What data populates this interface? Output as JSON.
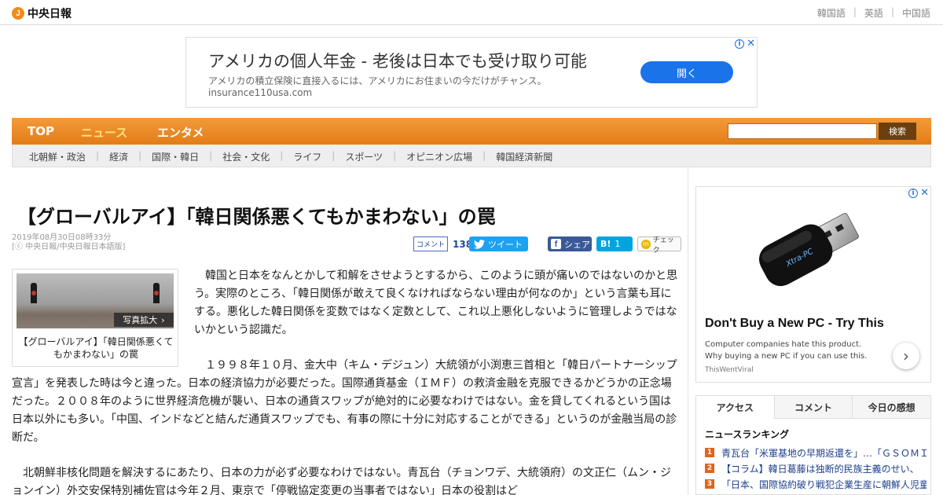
{
  "header": {
    "logo_text": "中央日報",
    "logo_mark": "J",
    "languages": [
      "韓国語",
      "英語",
      "中国語"
    ]
  },
  "top_ad": {
    "title": "アメリカの個人年金 - 老後は日本でも受け取り可能",
    "description": "アメリカの積立保険に直接入るには、アメリカにお住まいの今だけがチャンス。",
    "url": "insurance110usa.com",
    "button_label": "開く"
  },
  "nav": {
    "items": [
      {
        "label": "TOP"
      },
      {
        "label": "ニュース"
      },
      {
        "label": "エンタメ"
      }
    ],
    "active": "ニュース",
    "search_value": "",
    "search_button": "検索"
  },
  "subnav": [
    "北朝鮮・政治",
    "経済",
    "国際・韓日",
    "社会・文化",
    "ライフ",
    "スポーツ",
    "オピニオン広場",
    "韓国経済新聞"
  ],
  "article": {
    "headline": "【グローバルアイ】「韓日関係悪くてもかまわない」の罠",
    "date": "2019年08月30日08時33分",
    "source": "[ⓒ 中央日報/中央日報日本語版]",
    "comment_label": "コメント",
    "comment_count": "138",
    "tweet_label": "ツイート",
    "share_label": "シェア",
    "hatena_label": "B!",
    "hatena_count": "1",
    "check_label": "チェック",
    "photo_zoom_label": "写真拡大",
    "photo_caption": "【グローバルアイ】「韓日関係悪くてもかまわない」の罠",
    "paragraphs": [
      "韓国と日本をなんとかして和解をさせようとするから、このように頭が痛いのではないのかと思う。実際のところ、「韓日関係が敢えて良くなければならない理由が何なのか」という言葉も耳にする。悪化した韓日関係を変数ではなく定数として、これ以上悪化しないように管理しようではないかという認識だ。",
      "１９９８年１０月、金大中（キム・デジュン）大統領が小渕恵三首相と「韓日パートナーシップ宣言」を発表した時は今と違った。日本の経済協力が必要だった。国際通貨基金（ＩＭＦ）の救済金融を克服できるかどうかの正念場だった。２００８年のように世界経済危機が襲い、日本の通貨スワップが絶対的に必要なわけではない。金を貸してくれるという国は日本以外にも多い。「中国、インドなどと結んだ通貨スワップでも、有事の際に十分に対応することができる」というのが金融当局の診断だ。",
      "北朝鮮非核化問題を解決するにあたり、日本の力が必ず必要なわけではない。青瓦台（チョンワデ、大統領府）の文正仁（ムン・ジョンイン）外交安保特別補佐官は今年２月、東京で「停戦協定変更の当事者ではない」日本の役割はど"
    ]
  },
  "right_ad": {
    "badge_text": "Xtra-PC",
    "title": "Don't Buy a New PC - Try This",
    "description": "Computer companies hate this product. Why buying a new PC if you can use this.",
    "source": "ThisWentViral"
  },
  "ranking": {
    "tabs": [
      "アクセス",
      "コメント",
      "今日の感想"
    ],
    "active_tab": "アクセス",
    "title": "ニュースランキング",
    "items": [
      {
        "rank": "1",
        "text": "青瓦台「米軍基地の早期返還を」…「ＧＳＯＭＩＡ"
      },
      {
        "rank": "2",
        "text": "【コラム】韓日葛藤は独断的民族主義のせい、"
      },
      {
        "rank": "3",
        "text": "「日本、国際協約破り戦犯企業生産に朝鮮人児童"
      }
    ]
  },
  "colors": {
    "nav_orange": "#f08c24",
    "nav_active": "#ffe27a",
    "ad_button_blue": "#1a73e8",
    "rank_badge": "#e2631a"
  }
}
